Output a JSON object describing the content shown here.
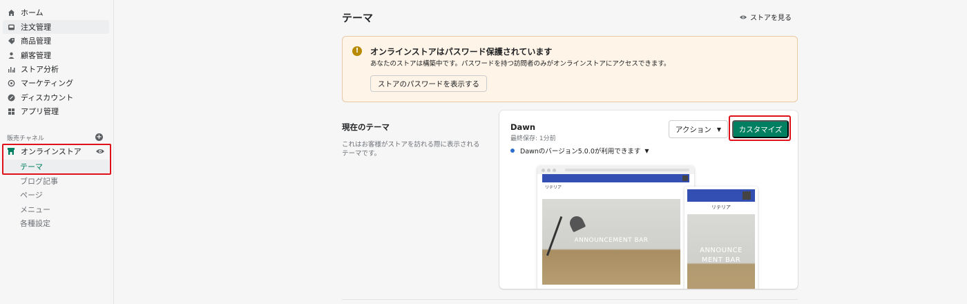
{
  "sidebar": {
    "items": [
      {
        "label": "ホーム",
        "icon": "home-icon"
      },
      {
        "label": "注文管理",
        "icon": "inbox-icon"
      },
      {
        "label": "商品管理",
        "icon": "tag-icon"
      },
      {
        "label": "顧客管理",
        "icon": "person-icon"
      },
      {
        "label": "ストア分析",
        "icon": "bar-chart-icon"
      },
      {
        "label": "マーケティング",
        "icon": "target-icon"
      },
      {
        "label": "ディスカウント",
        "icon": "discount-icon"
      },
      {
        "label": "アプリ管理",
        "icon": "apps-icon"
      }
    ],
    "sales_channels_label": "販売チャネル",
    "online_store": {
      "label": "オンラインストア"
    },
    "sub_items": [
      "テーマ",
      "ブログ記事",
      "ページ",
      "メニュー",
      "各種設定"
    ]
  },
  "header": {
    "title": "テーマ",
    "view_store": "ストアを見る"
  },
  "banner": {
    "title": "オンラインストアはパスワード保護されています",
    "text": "あなたのストアは構築中です。パスワードを持つ訪問者のみがオンラインストアにアクセスできます。",
    "button": "ストアのパスワードを表示する"
  },
  "current_theme": {
    "heading": "現在のテーマ",
    "description": "これはお客様がストアを訪れる際に表示されるテーマです。",
    "name": "Dawn",
    "last_saved": "最終保存: 1分前",
    "version_notice": "Dawnのバージョン5.0.0が利用できます",
    "actions_label": "アクション",
    "customize_label": "カスタマイズ",
    "preview": {
      "desktop_logo": "リテリア",
      "mobile_logo": "リテリア",
      "desktop_banner": "ANNOUNCEMENT BAR",
      "mobile_banner_line1": "ANNOUNCE",
      "mobile_banner_line2": "MENT BAR"
    }
  },
  "colors": {
    "accent": "#008060",
    "highlight": "#e0101a",
    "banner_bg": "#fff4e8"
  }
}
